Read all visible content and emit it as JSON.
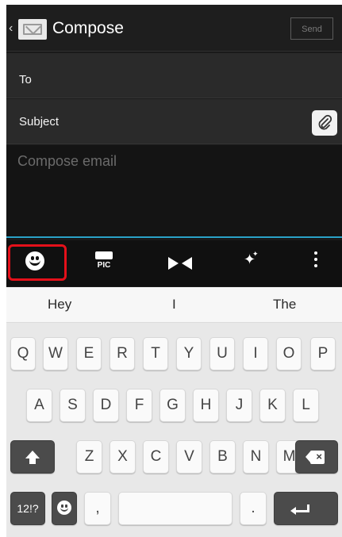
{
  "header": {
    "title": "Compose",
    "send_label": "Send",
    "back_icon": "chevron-left-icon",
    "app_icon": "email-app-icon"
  },
  "fields": {
    "to_label": "To",
    "subject_label": "Subject",
    "compose_placeholder": "Compose email"
  },
  "toolbar": {
    "pic_label": "PIC",
    "items": [
      "emoji-icon",
      "deco-pic-icon",
      "bow-icon",
      "sparkle-icon",
      "more-vert-icon"
    ]
  },
  "keyboard": {
    "suggestions": [
      "Hey",
      "I",
      "The"
    ],
    "row1": [
      "Q",
      "W",
      "E",
      "R",
      "T",
      "Y",
      "U",
      "I",
      "O",
      "P"
    ],
    "row2": [
      "A",
      "S",
      "D",
      "F",
      "G",
      "H",
      "J",
      "K",
      "L"
    ],
    "row3": [
      "Z",
      "X",
      "C",
      "V",
      "B",
      "N",
      "M"
    ],
    "symbols_label": "12!?",
    "comma": ",",
    "period": "."
  },
  "colors": {
    "highlight": "#e4101a",
    "accent": "#2aa2c8"
  }
}
